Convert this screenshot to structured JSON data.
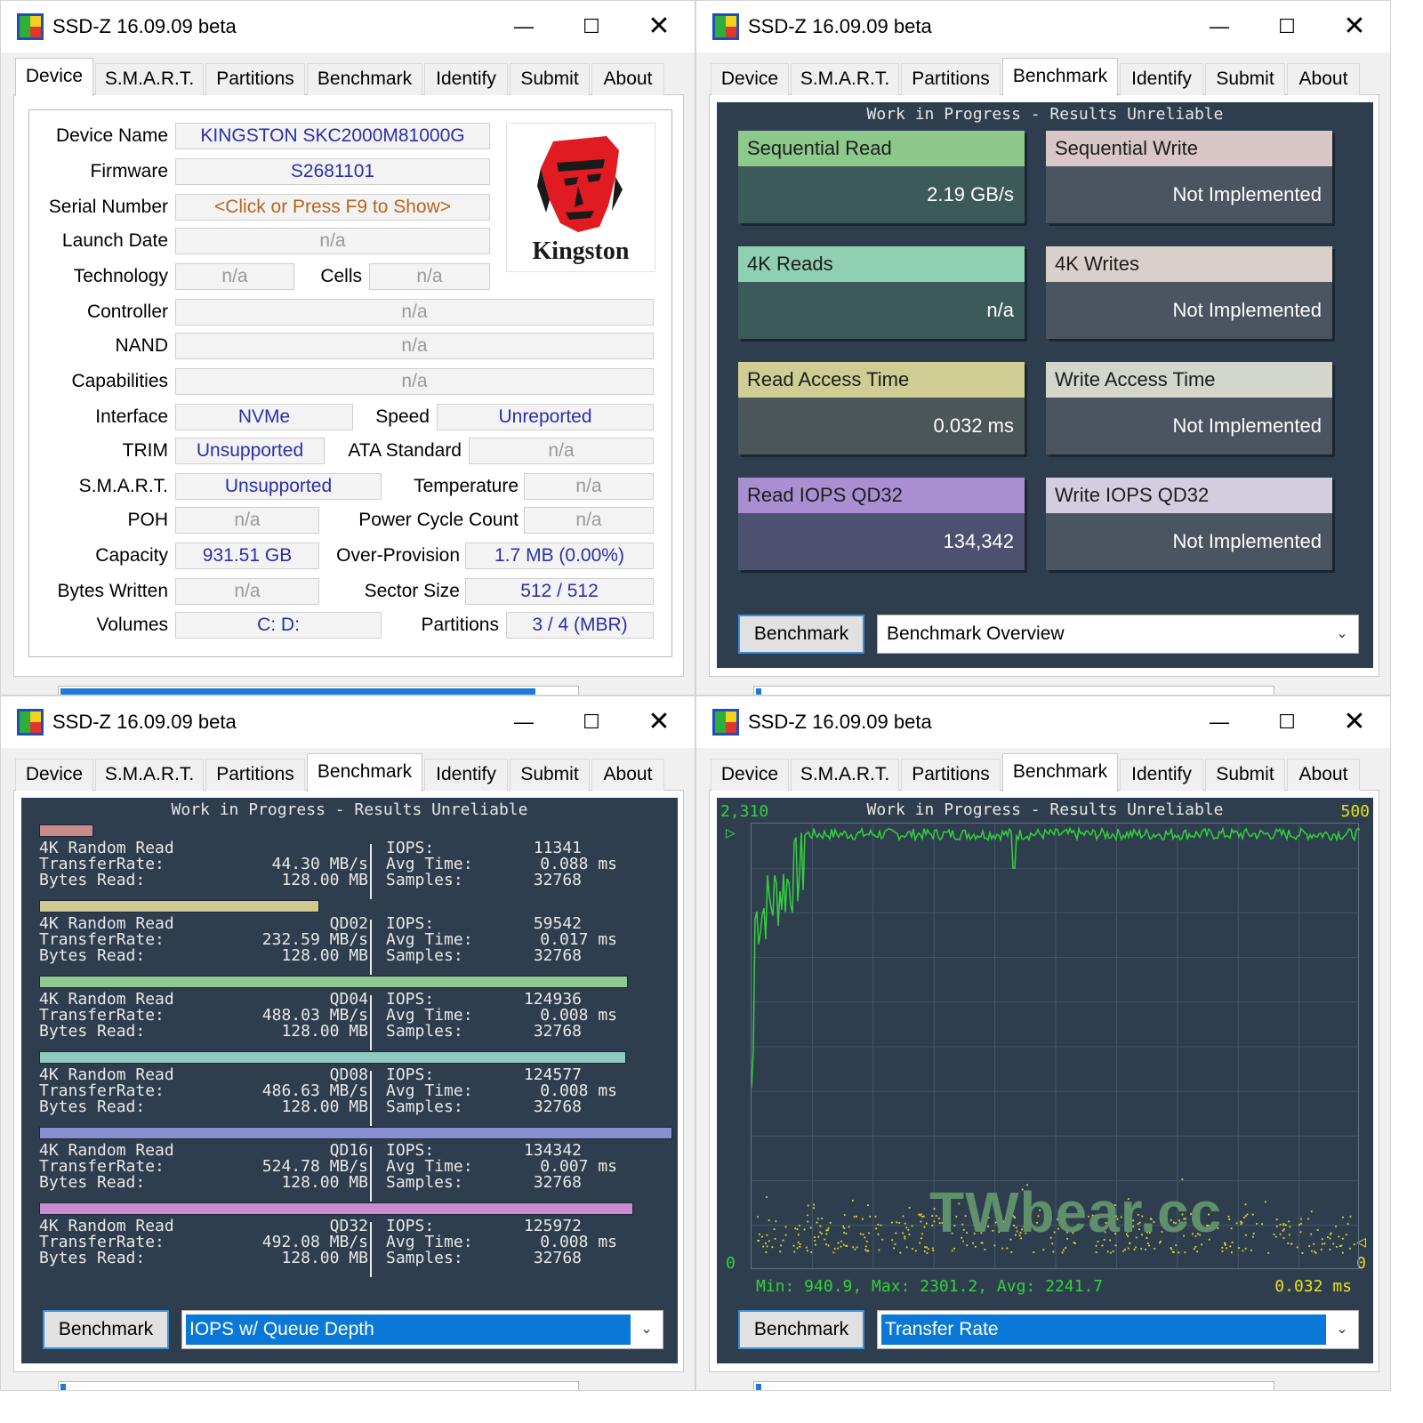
{
  "app": {
    "title": "SSD-Z 16.09.09 beta",
    "min_glyph": "—",
    "max_glyph": "☐",
    "close_glyph": "✕",
    "icon": "ssdz-app-icon"
  },
  "tabs": [
    "Device",
    "S.M.A.R.T.",
    "Partitions",
    "Benchmark",
    "Identify",
    "Submit",
    "About"
  ],
  "device": {
    "labels": {
      "device_name": "Device Name",
      "firmware": "Firmware",
      "serial": "Serial Number",
      "launch": "Launch Date",
      "technology": "Technology",
      "cells": "Cells",
      "controller": "Controller",
      "nand": "NAND",
      "capabilities": "Capabilities",
      "interface": "Interface",
      "speed": "Speed",
      "trim": "TRIM",
      "ata": "ATA Standard",
      "smart": "S.M.A.R.T.",
      "temperature": "Temperature",
      "poh": "POH",
      "power_cycle": "Power Cycle Count",
      "capacity": "Capacity",
      "overprov": "Over-Provision",
      "bytes_written": "Bytes Written",
      "sector": "Sector Size",
      "volumes": "Volumes",
      "partitions": "Partitions"
    },
    "values": {
      "device_name": "KINGSTON SKC2000M81000G",
      "firmware": "S2681101",
      "serial": "<Click or Press F9 to Show>",
      "launch": "n/a",
      "technology": "n/a",
      "cells": "n/a",
      "controller": "n/a",
      "nand": "n/a",
      "capabilities": "n/a",
      "interface": "NVMe",
      "speed": "Unreported",
      "trim": "Unsupported",
      "ata": "n/a",
      "smart": "Unsupported",
      "temperature": "n/a",
      "poh": "n/a",
      "power_cycle": "n/a",
      "capacity": "931.51 GB",
      "overprov": "1.7 MB (0.00%)",
      "bytes_written": "n/a",
      "sector": "512 / 512",
      "volumes": "C:  D:",
      "partitions": "3 / 4 (MBR)"
    },
    "logo_text": "Kingston",
    "progress": 0.92
  },
  "overview": {
    "banner": "Work in Progress - Results Unreliable",
    "cards": [
      {
        "title": "Sequential Read",
        "value": "2.19 GB/s",
        "head": "#8dc98a",
        "body": "#3c5a57"
      },
      {
        "title": "Sequential Write",
        "value": "Not Implemented",
        "head": "#d9c7c7",
        "body": "#4b5561"
      },
      {
        "title": "4K Reads",
        "value": "n/a",
        "head": "#8fcfb2",
        "body": "#3c5a57"
      },
      {
        "title": "4K Writes",
        "value": "Not Implemented",
        "head": "#d9cfcb",
        "body": "#4b5561"
      },
      {
        "title": "Read Access Time",
        "value": "0.032 ms",
        "head": "#cfcd94",
        "body": "#4a5658"
      },
      {
        "title": "Write Access Time",
        "value": "Not Implemented",
        "head": "#d2d6cb",
        "body": "#4b5561"
      },
      {
        "title": "Read IOPS QD32",
        "value": "134,342",
        "head": "#a98fd2",
        "body": "#4c5170"
      },
      {
        "title": "Write IOPS QD32",
        "value": "Not Implemented",
        "head": "#d3cde0",
        "body": "#4b5561"
      }
    ],
    "button": "Benchmark",
    "mode": "Benchmark Overview",
    "progress": 0.01
  },
  "qd": {
    "banner": "Work in Progress - Results Unreliable",
    "button": "Benchmark",
    "mode": "IOPS w/ Queue Depth",
    "progress": 0.01,
    "rows": [
      {
        "title": "4K Random Read",
        "qd": "",
        "rate": "44.30 MB/s",
        "bytes": "128.00 MB",
        "iops": "11341",
        "avg": "0.088 ms",
        "samples": "32768",
        "fill": 0.085,
        "color": "#c98a8a"
      },
      {
        "title": "4K Random Read",
        "qd": "QD02",
        "rate": "232.59 MB/s",
        "bytes": "128.00 MB",
        "iops": "59542",
        "avg": "0.017 ms",
        "samples": "32768",
        "fill": 0.443,
        "color": "#cfc98f"
      },
      {
        "title": "4K Random Read",
        "qd": "QD04",
        "rate": "488.03 MB/s",
        "bytes": "128.00 MB",
        "iops": "124936",
        "avg": "0.008 ms",
        "samples": "32768",
        "fill": 0.93,
        "color": "#8fc98f"
      },
      {
        "title": "4K Random Read",
        "qd": "QD08",
        "rate": "486.63 MB/s",
        "bytes": "128.00 MB",
        "iops": "124577",
        "avg": "0.008 ms",
        "samples": "32768",
        "fill": 0.927,
        "color": "#8fc9c0"
      },
      {
        "title": "4K Random Read",
        "qd": "QD16",
        "rate": "524.78 MB/s",
        "bytes": "128.00 MB",
        "iops": "134342",
        "avg": "0.007 ms",
        "samples": "32768",
        "fill": 1.0,
        "color": "#8a8fd2"
      },
      {
        "title": "4K Random Read",
        "qd": "QD32",
        "rate": "492.08 MB/s",
        "bytes": "128.00 MB",
        "iops": "125972",
        "avg": "0.008 ms",
        "samples": "32768",
        "fill": 0.938,
        "color": "#c98ad2"
      }
    ],
    "labels": {
      "transfer": "TransferRate:",
      "bytes": "Bytes Read:",
      "iops": "IOPS:",
      "avg": "Avg Time:",
      "samples": "Samples:"
    }
  },
  "transfer": {
    "banner": "Work in Progress - Results Unreliable",
    "y_left_max": "2,310",
    "y_right_max": "500",
    "y_left_min": "0",
    "y_right_min": "0",
    "footer_stats": "Min: 940.9, Max: 2301.2, Avg: 2241.7",
    "footer_time": "0.032 ms",
    "watermark": "TWbear.cc",
    "button": "Benchmark",
    "mode": "Transfer Rate",
    "progress": 0.01,
    "colors": {
      "rate": "#34d13a",
      "access": "#e3e31b",
      "grid": "#44576a"
    }
  }
}
